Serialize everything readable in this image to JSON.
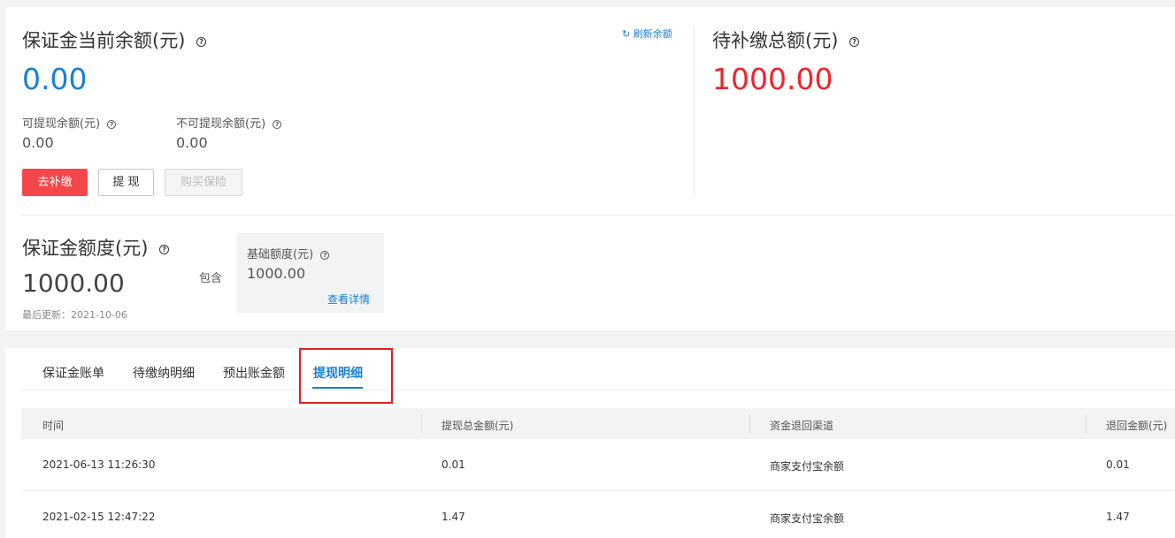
{
  "balance": {
    "title": "保证金当前余额(元)",
    "amount": "0.00",
    "refresh_label": "刷新余额",
    "withdrawable_label": "可提现余额(元)",
    "withdrawable_value": "0.00",
    "non_withdrawable_label": "不可提现余额(元)",
    "non_withdrawable_value": "0.00",
    "buttons": {
      "topup": "去补缴",
      "withdraw": "提 现",
      "buy_insurance": "购买保险"
    }
  },
  "pending": {
    "title": "待补缴总额(元)",
    "amount": "1000.00"
  },
  "quota": {
    "title": "保证金额度(元)",
    "amount": "1000.00",
    "updated": "最后更新：2021-10-06",
    "contains_label": "包含",
    "base_label": "基础额度(元)",
    "base_value": "1000.00",
    "details_link": "查看详情"
  },
  "tabs": [
    {
      "label": "保证金账单",
      "active": false
    },
    {
      "label": "待缴纳明细",
      "active": false
    },
    {
      "label": "预出账金额",
      "active": false
    },
    {
      "label": "提现明细",
      "active": true
    }
  ],
  "table": {
    "headers": [
      "时间",
      "提现总金额(元)",
      "资金退回渠道",
      "退回金额(元)"
    ],
    "rows": [
      [
        "2021-06-13 11:26:30",
        "0.01",
        "商家支付宝余额",
        "0.01"
      ],
      [
        "2021-02-15 12:47:22",
        "1.47",
        "商家支付宝余额",
        "1.47"
      ]
    ]
  },
  "colors": {
    "accent_blue": "#1a80d0",
    "alert_red": "#f0232c",
    "button_red": "#f3474c",
    "highlight_red": "#e02020"
  }
}
